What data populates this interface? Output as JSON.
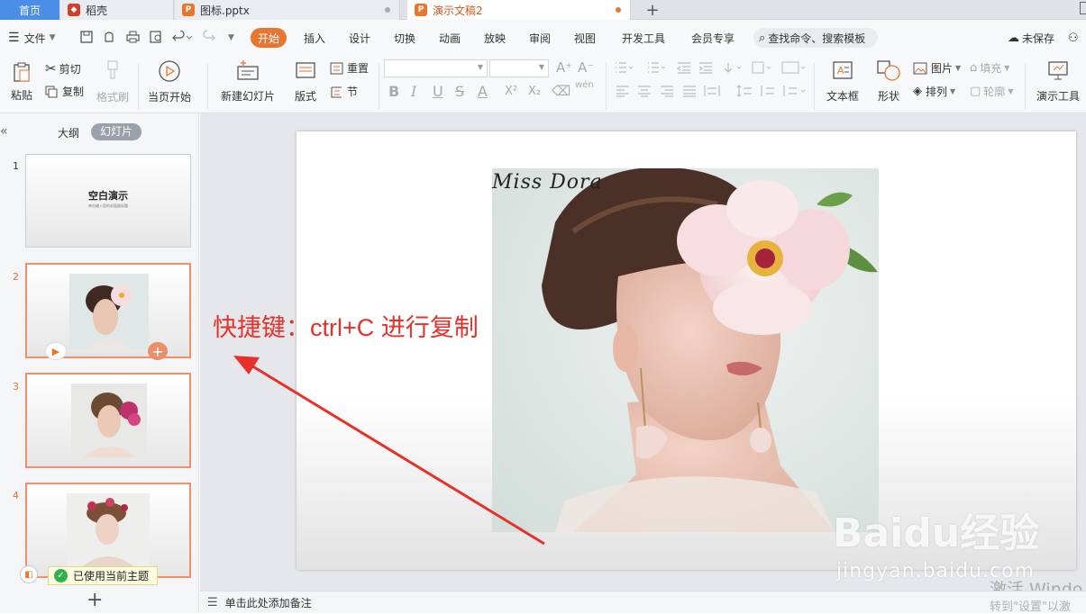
{
  "tabs": {
    "home": "首页",
    "docs": [
      {
        "label": "稻壳",
        "icon": "daoke-icon",
        "color": "#d0402a"
      },
      {
        "label": "图标.pptx",
        "icon": "ppt-icon",
        "color": "#e8762f"
      },
      {
        "label": "演示文稿2",
        "icon": "ppt-icon",
        "color": "#e8762f"
      }
    ],
    "add": "+"
  },
  "menu": {
    "file": "文件",
    "items": [
      "开始",
      "插入",
      "设计",
      "切换",
      "动画",
      "放映",
      "审阅",
      "视图",
      "开发工具",
      "会员专享"
    ],
    "search_placeholder": "查找命令、搜索模板",
    "unsaved": "未保存"
  },
  "ribbon": {
    "paste": "粘贴",
    "cut": "剪切",
    "copy": "复制",
    "format_painter": "格式刷",
    "play_from_current": "当页开始",
    "new_slide": "新建幻灯片",
    "layout": "版式",
    "reset": "重置",
    "section": "节",
    "textbox": "文本框",
    "shape": "形状",
    "picture": "图片",
    "fill": "填充",
    "arrange": "排列",
    "outline": "轮廓",
    "presentation_tools": "演示工具",
    "font_size_up": "A⁺",
    "font_size_down": "A⁻",
    "bold": "B",
    "italic": "I",
    "underline": "U",
    "strike": "S",
    "font_color": "A",
    "superscript": "X²",
    "subscript": "X₂",
    "wen": "wén"
  },
  "left_panel": {
    "tab_outline": "大纲",
    "tab_slides": "幻灯片",
    "slides": [
      {
        "num": "1",
        "title": "空白演示",
        "subtitle": "单击输入您的封面副标题"
      },
      {
        "num": "2"
      },
      {
        "num": "3"
      },
      {
        "num": "4"
      }
    ],
    "theme_notice": "已使用当前主题",
    "add_slide": "+"
  },
  "slide": {
    "signature": "Miss Dora",
    "annotation": "快捷键：ctrl+C 进行复制",
    "annotation_color": "#e8302a"
  },
  "notes_placeholder": "单击此处添加备注",
  "watermark": {
    "brand": "Baidu经验",
    "url": "jingyan.baidu.com",
    "activate_line1": "激活 Windo",
    "activate_line2": "转到\"设置\"以激"
  }
}
